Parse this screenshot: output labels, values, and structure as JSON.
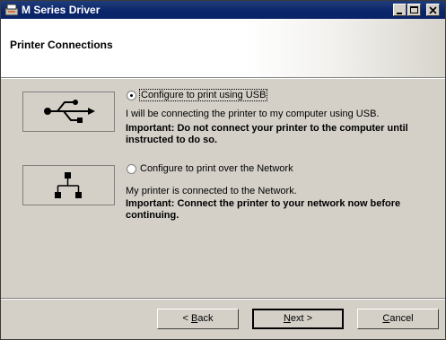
{
  "window": {
    "title": "M Series Driver"
  },
  "header": {
    "title": "Printer Connections"
  },
  "options": [
    {
      "selected": true,
      "label": "Configure to print using USB",
      "description": "I will be connecting the printer to my computer using USB.",
      "important_1": "Important: Do not connect your printer to the computer until",
      "important_2": "instructed to do so.",
      "icon": "usb-icon"
    },
    {
      "selected": false,
      "label": "Configure to print over the Network",
      "description": "My printer is connected to the Network.",
      "important_1": "Important: Connect the printer to your network now before",
      "important_2": "continuing.",
      "icon": "network-icon"
    }
  ],
  "buttons": {
    "back_prefix": "< ",
    "back_key": "B",
    "back_rest": "ack",
    "next_key": "N",
    "next_rest": "ext >",
    "cancel_key": "C",
    "cancel_rest": "ancel"
  }
}
